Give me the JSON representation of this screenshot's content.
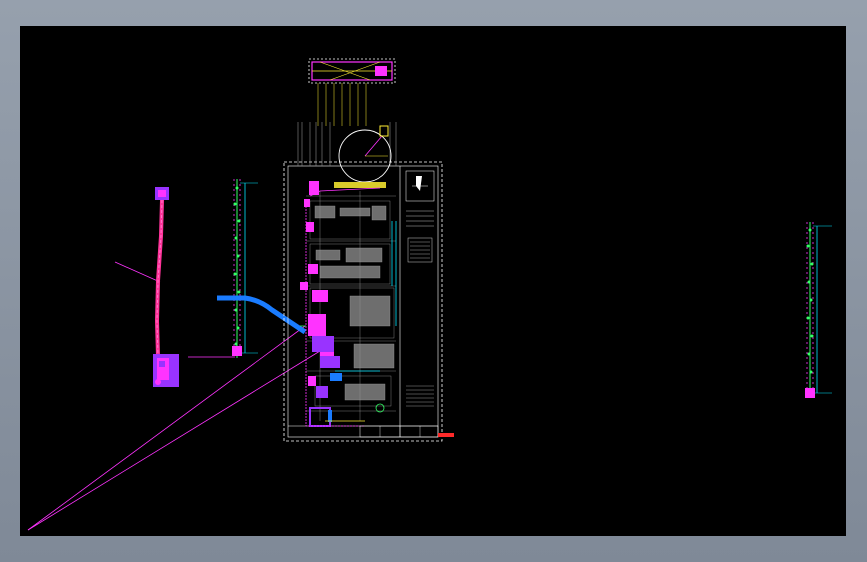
{
  "viewer": {
    "canvas_background": "#000000",
    "frame_color": "#8b95a3"
  },
  "colors": {
    "magenta": "#ff33ff",
    "pink": "#ff3399",
    "violet": "#9933ff",
    "blue": "#1a7cff",
    "cyan": "#00e5ff",
    "green": "#33ff66",
    "yellow": "#ffee33",
    "white": "#ffffff",
    "gray": "#8a8a8a",
    "red": "#ff2a2a"
  },
  "elements": {
    "title_block": "title-block",
    "main_sheet": "main-plan-sheet",
    "left_elevation": "left-elevation-strip",
    "right_elevation": "right-elevation-strip",
    "pipe_profile": "pipe-profile-detail",
    "top_section": "top-section-detail"
  }
}
